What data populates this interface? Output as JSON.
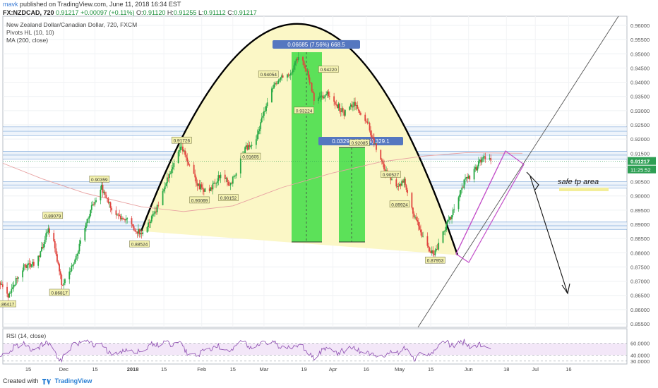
{
  "header": {
    "author": "mavk",
    "published_text": "published on TradingView.com, June 11, 2018 16:34 EST",
    "symbol": "FX:NZDCAD, 720",
    "last": "0.91217",
    "change": "+0.00097 (+0.11%)",
    "o_label": "O:",
    "o_value": "0.91120",
    "h_label": "H:",
    "h_value": "0.91255",
    "l_label": "L:",
    "l_value": "0.91112",
    "c_label": "C:",
    "c_value": "0.91217"
  },
  "legend": {
    "title": "New Zealand Dollar/Canadian Dollar, 720, FXCM",
    "pivots": "Pivots HL (10, 10)",
    "ma": "MA (200, close)"
  },
  "rsi": {
    "label": "RSI (14, close)"
  },
  "annotations": {
    "measure_big": "0.06685 (7.56%) 668.5",
    "measure_small": "0.03291 (3.72%) 329.1",
    "safe_tp": "safe tp area",
    "price_badge": "0.91217",
    "time_badge": "11:25:52"
  },
  "footer": {
    "created_with": "Created with",
    "brand": "TradingView"
  },
  "colors": {
    "up": "#27a844",
    "down": "#e0433d",
    "parabola_fill": "#fbf7c6",
    "measure_green": "#3fdd45",
    "band_blue": "#5a8fd0",
    "channel": "#c34fc9",
    "rsi_line": "#8c4cb0",
    "rsi_fill": "#f2e4f7",
    "ma_line": "#e8a2a2",
    "label_blue": "#5577c0"
  },
  "chart_data": {
    "type": "candlestick",
    "ylim": [
      0.8525,
      0.9625
    ],
    "y_ticks": [
      "0.96000",
      "0.95500",
      "0.95000",
      "0.94500",
      "0.94000",
      "0.93500",
      "0.93000",
      "0.92500",
      "0.92000",
      "0.91500",
      "0.91000",
      "0.90500",
      "0.90000",
      "0.89500",
      "0.89000",
      "0.88500",
      "0.88000",
      "0.87500",
      "0.87000",
      "0.86500",
      "0.86000",
      "0.85500"
    ],
    "x_ticks": [
      "15",
      "Dec",
      "15",
      "2018",
      "15",
      "Feb",
      "15",
      "Mar",
      "19",
      "Apr",
      "16",
      "May",
      "15",
      "Jun",
      "18",
      "Jul",
      "16"
    ],
    "x_tick_dates": [
      "2017-11-15",
      "2017-12-01",
      "2017-12-15",
      "2018-01-01",
      "2018-01-15",
      "2018-02-01",
      "2018-02-15",
      "2018-03-01",
      "2018-03-19",
      "2018-04-01",
      "2018-04-16",
      "2018-05-01",
      "2018-05-15",
      "2018-06-01",
      "2018-06-18",
      "2018-07-01",
      "2018-07-16"
    ],
    "pivot_labels": [
      {
        "date": "2017-11-05",
        "value": "0.86417",
        "pos": "low"
      },
      {
        "date": "2017-11-29",
        "value": "0.86817",
        "pos": "low"
      },
      {
        "date": "2017-11-26",
        "value": "0.89079",
        "pos": "high"
      },
      {
        "date": "2017-12-17",
        "value": "0.90359",
        "pos": "high"
      },
      {
        "date": "2018-01-04",
        "value": "0.88524",
        "pos": "low"
      },
      {
        "date": "2018-01-23",
        "value": "0.91726",
        "pos": "high"
      },
      {
        "date": "2018-01-31",
        "value": "0.90069",
        "pos": "low"
      },
      {
        "date": "2018-02-13",
        "value": "0.90152",
        "pos": "low"
      },
      {
        "date": "2018-02-23",
        "value": "0.91605",
        "pos": "low"
      },
      {
        "date": "2018-03-03",
        "value": "0.94054",
        "pos": "high"
      },
      {
        "date": "2018-03-19",
        "value": "0.93224",
        "pos": "low"
      },
      {
        "date": "2018-03-30",
        "value": "0.94220",
        "pos": "high"
      },
      {
        "date": "2018-04-13",
        "value": "0.92085",
        "pos": "low"
      },
      {
        "date": "2018-04-27",
        "value": "0.90527",
        "pos": "high"
      },
      {
        "date": "2018-05-01",
        "value": "0.89924",
        "pos": "low"
      },
      {
        "date": "2018-05-17",
        "value": "0.87953",
        "pos": "low"
      }
    ],
    "ohlc_series": "NZDCAD 720-minute bars, Oct 2017 – Jun 2018 (values shown as chart geometry)",
    "last_price": 0.91217,
    "rsi_levels": [
      60,
      40,
      30
    ],
    "rsi_ticks": [
      "60.0000",
      "40.0000",
      "30.0000"
    ]
  }
}
